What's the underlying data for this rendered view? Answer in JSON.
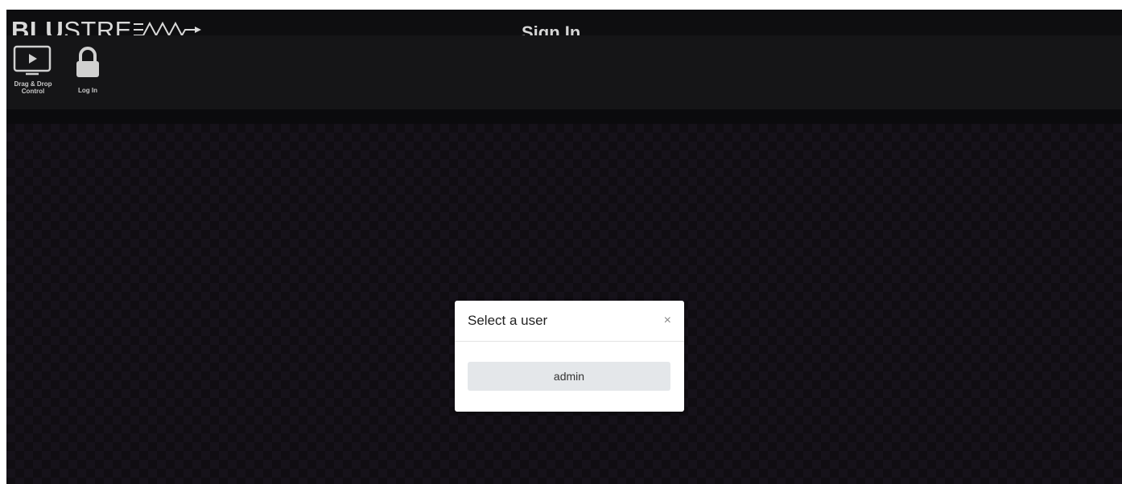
{
  "brand": {
    "logo_bold": "BLU",
    "logo_thin": "STRE"
  },
  "header": {
    "title": "Sign In"
  },
  "nav": {
    "items": [
      {
        "label_line1": "Drag & Drop",
        "label_line2": "Control",
        "icon": "play-screen-icon"
      },
      {
        "label": "Log In",
        "icon": "lock-icon",
        "active": true
      }
    ]
  },
  "modal": {
    "title": "Select a user",
    "close_symbol": "×",
    "users": [
      "admin"
    ]
  },
  "colors": {
    "accent": "#2b6ea3",
    "background": "#0b0b0d",
    "navbar": "#151517"
  }
}
